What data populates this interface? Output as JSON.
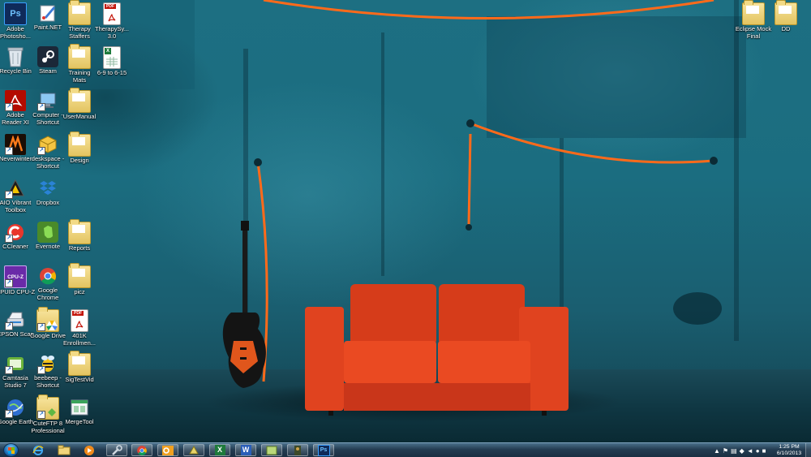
{
  "desktop_icons": {
    "photoshop": "Adobe\nPhotosho...",
    "paintnet": "Paint.NET",
    "therapy_staffers": "Therapy\nStaffers",
    "therapysy": "TherapySy...\n3.0",
    "recycle_bin": "Recycle Bin",
    "steam": "Steam",
    "training_mats": "Training\nMats",
    "file_6_9": "6-9 to 6-15",
    "adobe_reader": "Adobe\nReader XI",
    "computer": "Computer -\nShortcut",
    "usermanual": "UserManual",
    "neverwinter": "Neverwinter",
    "deskspace": "deskspace -\nShortcut",
    "design": "Design",
    "aio_toolbox": "AIO Vibrant\nToolbox",
    "dropbox": "Dropbox",
    "ccleaner": "CCleaner",
    "evernote": "Evernote",
    "reports": "Reports",
    "cpuz": "CPUID CPU-Z",
    "chrome": "Google\nChrome",
    "picz": "picz",
    "epson": "EPSON Scan",
    "gdrive": "Google Drive",
    "k401": "401K\nEnrollmen...",
    "camtasia": "Camtasia\nStudio 7",
    "beebeep": "beebeep -\nShortcut",
    "sigtestvid": "SigTestVid",
    "google_earth": "Google Earth",
    "cuteftp": "CuteFTP 8\nProfessional",
    "mergetool": "MergeTool",
    "eclipse": "Eclipse Mock\nFinal",
    "dd": "DD"
  },
  "icon_glyphs": {
    "photoshop": "Ps",
    "pdf_badge": "PDF",
    "taskbar_photoshop": "Ps",
    "taskbar_word": "W",
    "taskbar_excel": "X",
    "cpuz": "CPU-Z"
  },
  "taskbar": {
    "pinned": [
      "internet-explorer-icon",
      "windows-explorer-icon",
      "media-player-icon",
      "tools-icon",
      "chrome-icon",
      "outlook-icon",
      "utility-icon",
      "excel-icon",
      "word-icon",
      "folder-app-icon",
      "game-icon",
      "photoshop-icon"
    ]
  },
  "clock": {
    "time": "1:25 PM",
    "date": "6/10/2013"
  },
  "colors": {
    "wall": "#1d6f82",
    "sofa": "#e0431f",
    "cable": "#ff6a1a",
    "taskbar": "#243d52"
  }
}
